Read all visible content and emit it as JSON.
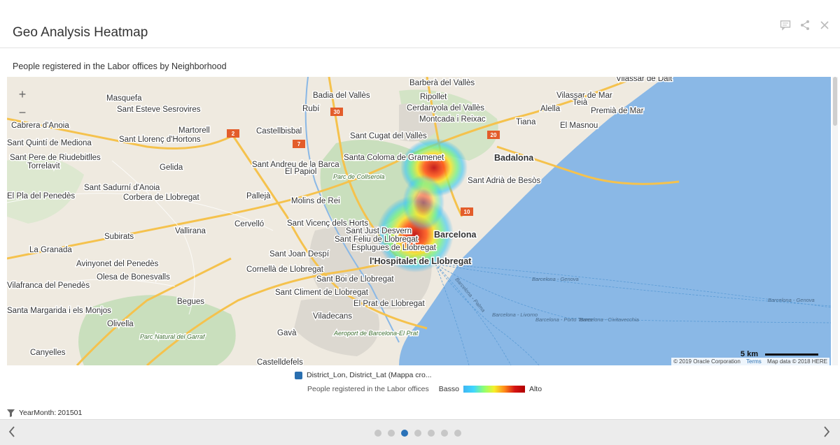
{
  "header": {
    "title": "Geo Analysis Heatmap",
    "icons": [
      "comment-icon",
      "share-icon",
      "close-icon"
    ]
  },
  "subtitle": "People registered in the Labor offices by Neighborhood",
  "map": {
    "zoom_in": "+",
    "zoom_out": "−",
    "scale_label": "5 km",
    "attribution": {
      "copyright": "© 2019 Oracle Corporation",
      "terms": "Terms",
      "map_data": "Map data © 2018 HERE"
    },
    "places": {
      "vilassar_dalt": "Vilassar de Dalt",
      "badia": "Badia del Vallès",
      "barbera": "Barberà del Vallès",
      "vilassar_mar": "Vilassar de Mar",
      "masquefa": "Masquefa",
      "ripollet": "Ripollet",
      "teia": "Teià",
      "esteve": "Sant Esteve Sesrovires",
      "rubi": "Rubí",
      "cerdanyola": "Cerdanyola del Vallès",
      "alella": "Alella",
      "premia": "Premià de Mar",
      "cabrera": "Cabrera d'Anoia",
      "montcada": "Montcada i Reixac",
      "tiana": "Tiana",
      "masnou": "El Masnou",
      "martorell": "Martorell",
      "castellbisbal": "Castellbisbal",
      "mediona": "Sant Quintí de Mediona",
      "llorenc": "Sant Llorenç d'Hortons",
      "cugat": "Sant Cugat del Vallès",
      "pere": "Sant Pere de Riudebitlles",
      "coloma": "Santa Coloma de Gramenet",
      "badalona": "Badalona",
      "torrelavit": "Torrelavit",
      "gelida": "Gelida",
      "andreu": "Sant Andreu de la Barca",
      "papiol": "El Papiol",
      "collserola": "Parc de Collserola",
      "adria": "Sant Adrià de Besòs",
      "sadurni": "Sant Sadurní d'Anoia",
      "pla": "El Pla del Penedès",
      "corbera": "Corbera de Llobregat",
      "pallejà": "Pallejà",
      "molins": "Molins de Rei",
      "cervello": "Cervelló",
      "vicenc": "Sant Vicenç dels Horts",
      "vallirana": "Vallirana",
      "just": "Sant Just Desvern",
      "barcelona": "Barcelona",
      "subirats": "Subirats",
      "feliu": "Sant Feliu de Llobregat",
      "esplugues": "Esplugues de Llobregat",
      "granada": "La Granada",
      "despi": "Sant Joan Despí",
      "hospitalet": "l'Hospitalet de Llobregat",
      "avinyonet": "Avinyonet del Penedès",
      "cornella": "Cornellà de Llobregat",
      "olesa": "Olesa de Bonesvalls",
      "boi": "Sant Boi de Llobregat",
      "vilafranca": "Vilafranca del Penedès",
      "climent": "Sant Climent de Llobregat",
      "begues": "Begues",
      "prat": "El Prat de Llobregat",
      "margarida": "Santa Margarida i els Monjos",
      "viladecans": "Viladecans",
      "olivella": "Olivella",
      "garraf": "Parc Natural del Garraf",
      "gava": "Gavà",
      "aeroport": "Aeroport de Barcelona-El Prat",
      "canyelles": "Canyelles",
      "castelldefels": "Castelldefels"
    },
    "roads": [
      "30",
      "2",
      "7",
      "20",
      "10"
    ],
    "ferry_routes": [
      "Barcelona - Genova",
      "Barcelona - Genova",
      "Barcelona - Palma",
      "Barcelona - Livorno",
      "Barcelona - Porto Torres",
      "Barcelona - Civitavecchia"
    ]
  },
  "legend": {
    "layer_name": "District_Lon, District_Lat (Mappa cro...",
    "measure": "People registered in the Labor offices",
    "low": "Basso",
    "high": "Alto"
  },
  "filter": {
    "label": "YearMonth:",
    "value": "201501"
  },
  "pager": {
    "pages": 7,
    "active_page": 3
  },
  "colors": {
    "sea": "#8ab8e6",
    "land": "#efeae0",
    "park": "#c9dfbd",
    "urban": "#dcd8d0",
    "road": "#f5c24d",
    "accent": "#2a72b8"
  }
}
